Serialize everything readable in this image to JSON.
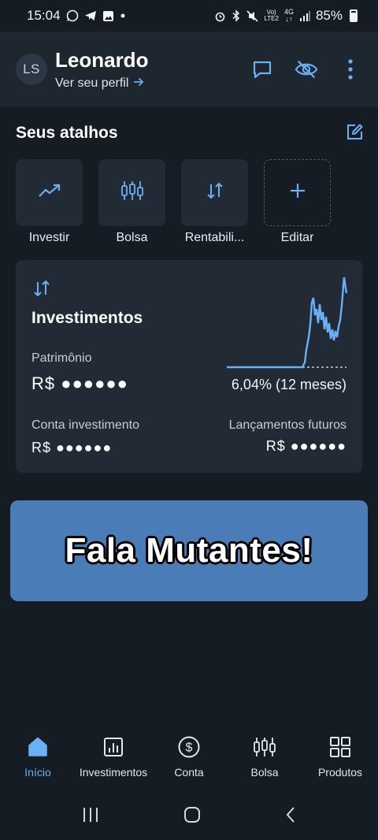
{
  "status_bar": {
    "time": "15:04",
    "battery": "85%",
    "left_icons": [
      "whatsapp-icon",
      "telegram-icon",
      "gallery-icon",
      "dot-icon"
    ],
    "right_icons": [
      "alarm-icon",
      "bluetooth-icon",
      "mute-icon",
      "volte-icon",
      "4g-icon",
      "signal-icon",
      "battery-icon"
    ]
  },
  "header": {
    "avatar_initials": "LS",
    "user_name": "Leonardo",
    "profile_link": "Ver seu perfil",
    "actions": [
      "chat-icon",
      "eye-off-icon",
      "more-vertical-icon"
    ]
  },
  "shortcuts": {
    "title": "Seus atalhos",
    "items": [
      {
        "label": "Investir",
        "icon": "trending-up-icon"
      },
      {
        "label": "Bolsa",
        "icon": "candlestick-icon"
      },
      {
        "label": "Rentabili...",
        "icon": "swap-vertical-icon"
      },
      {
        "label": "Editar",
        "icon": "plus-icon"
      }
    ]
  },
  "investments": {
    "title": "Investimentos",
    "patrimonio_label": "Patrimônio",
    "patrimonio_value": "R$ ●●●●●●",
    "chart_caption": "6,04% (12 meses)",
    "conta_label": "Conta investimento",
    "conta_value": "R$ ●●●●●●",
    "lancamentos_label": "Lançamentos futuros",
    "lancamentos_value": "R$ ●●●●●●",
    "chart_line_color": "#6ab0f5"
  },
  "banner": {
    "text": "Fala Mutantes!",
    "color": "#4a7db8"
  },
  "bottom_nav": {
    "items": [
      {
        "label": "Início",
        "icon": "home-icon",
        "active": true
      },
      {
        "label": "Investimentos",
        "icon": "bar-chart-icon",
        "active": false
      },
      {
        "label": "Conta",
        "icon": "dollar-circle-icon",
        "active": false
      },
      {
        "label": "Bolsa",
        "icon": "candlestick-icon",
        "active": false
      },
      {
        "label": "Produtos",
        "icon": "grid-icon",
        "active": false
      }
    ]
  },
  "colors": {
    "background": "#161c24",
    "card": "#212a35",
    "accent": "#6ab0f5"
  }
}
